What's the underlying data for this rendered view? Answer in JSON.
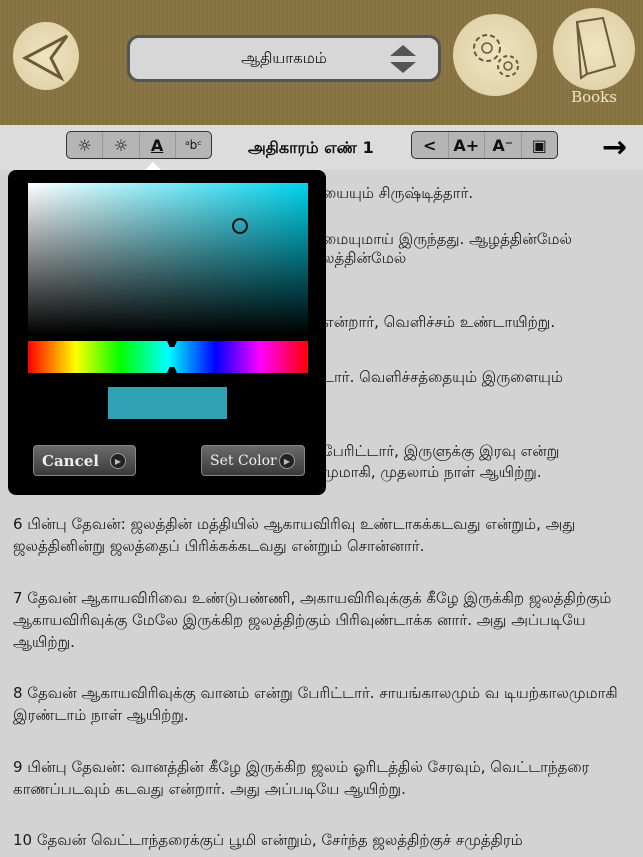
{
  "header": {
    "book_selector": "ஆதியாகமம்",
    "books_label": "Books"
  },
  "toolbar": {
    "chapter_title": "அதிகாரம் எண் 1",
    "text_color_glyph": "A",
    "bg_color_glyph": "ᵃbᶜ",
    "font_increase": "A+",
    "font_decrease": "A⁻",
    "next_arrow": "→"
  },
  "color_picker": {
    "selected_color": "#2fa3b5",
    "cancel_label": "Cancel",
    "set_color_label": "Set Color"
  },
  "partial_verses": [
    {
      "line1": "யையும் சிருஷ்டித்தார்."
    },
    {
      "line1": "மையுமாய் இருந்தது. ஆழத்தின்மேல்",
      "line2": "லத்தின்மேல்"
    },
    {
      "line1": "என்றார், வெளிச்சம் உண்டாயிற்று."
    },
    {
      "line1": "டார். வெளிச்சத்தையும் இருளையும்"
    },
    {
      "line1": "பேரிட்டார், இருளுக்கு இரவு என்று",
      "line2": "முமாகி, முதலாம் நாள் ஆயிற்று."
    }
  ],
  "verses": [
    "6 பின்பு தேவன்: ஜலத்தின் மத்தியில் ஆகாயவிரிவு உண்டாகக்கடவது என்றும், அது ஜலத்தினின்று ஜலத்தைப் பிரிக்கக்கடவது என்றும் சொன்னார்.",
    "7 தேவன் ஆகாயவிரிவை உண்டுபண்ணி, அகாயவிரிவுக்குக் கீழே இருக்கிற ஜலத்திற்கும் ஆகாயவிரிவுக்கு மேலே இருக்கிற ஜலத்திற்கும் பிரிவுண்டாக்க னார். அது அப்படியே ஆயிற்று.",
    "8 தேவன் ஆகாயவிரிவுக்கு வானம் என்று பேரிட்டார். சாயங்காலமும் வ டியற்காலமுமாகி இரண்டாம் நாள் ஆயிற்று.",
    "9 பின்பு தேவன்: வானத்தின் கீழே இருக்கிற ஜலம் ஓரிடத்தில் சேரவும், வெட்டாந்தரை காணப்படவும் கடவது என்றார். அது அப்படியே ஆயிற்று.",
    "10 தேவன் வெட்டாந்தரைக்குப் பூமி என்றும், சேர்ந்த ஜலத்திற்குச் சமுத்திரம்"
  ]
}
